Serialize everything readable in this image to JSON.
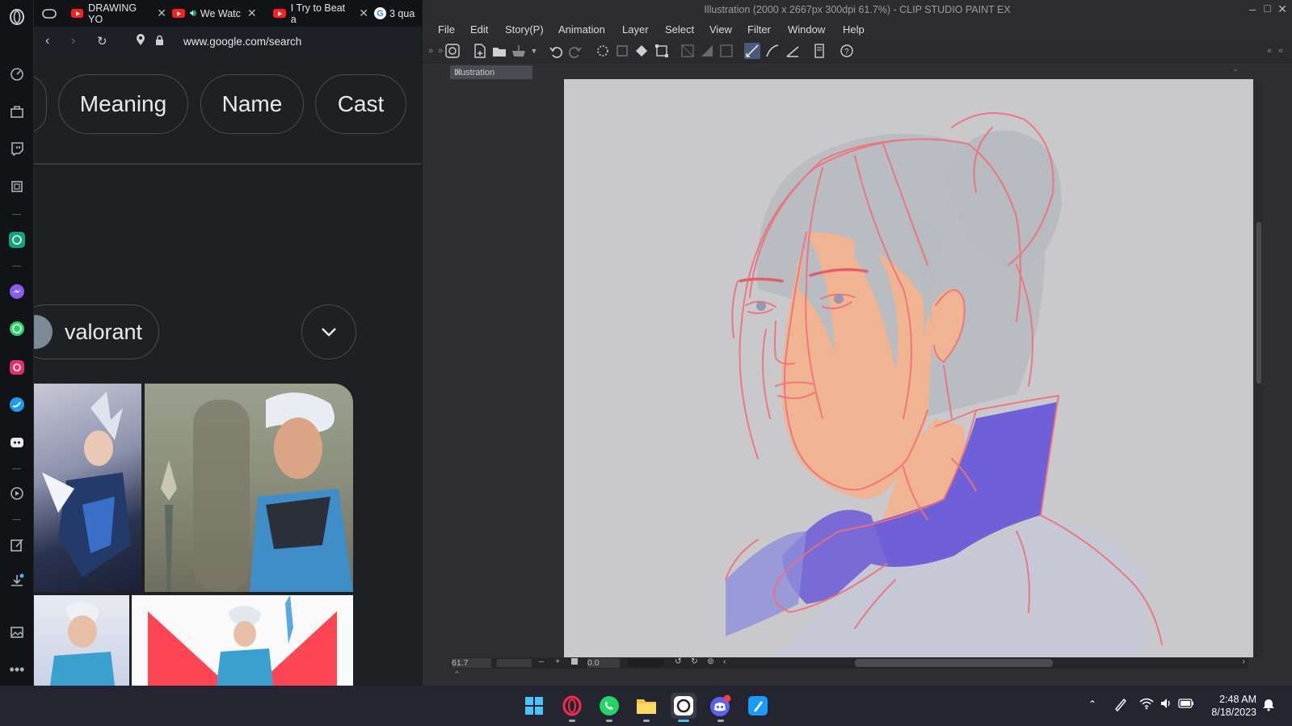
{
  "browser": {
    "tabs": [
      {
        "label": "DRAWING YO"
      },
      {
        "label": "We Watc"
      },
      {
        "label": "I Try to Beat a"
      },
      {
        "label": "3 qua"
      }
    ],
    "url": "www.google.com/search"
  },
  "google": {
    "chips": [
      "Meaning",
      "Name",
      "Cast"
    ],
    "query_chip": "valorant"
  },
  "csp": {
    "title": "Illustration (2000 x 2667px 300dpi 61.7%) - CLIP STUDIO PAINT EX",
    "menu": [
      "File",
      "Edit",
      "Story(P)",
      "Animation",
      "Layer",
      "Select",
      "View",
      "Filter",
      "Window",
      "Help"
    ],
    "doc_tab": "Illustration",
    "zoom": "61.7",
    "rotation": "0.0"
  },
  "taskbar": {
    "time": "2:48 AM",
    "date": "8/18/2023"
  },
  "colors": {
    "sketch": "#ef6f7c",
    "canvas_bg": "#c9c9cb",
    "skin": "#f0b493",
    "collar": "#7060d8"
  }
}
